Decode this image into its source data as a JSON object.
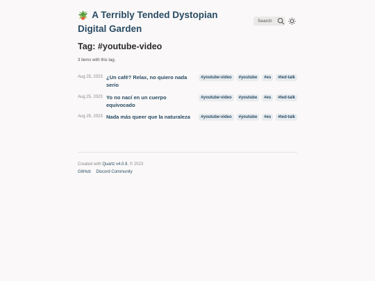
{
  "header": {
    "logo_emoji": "🪴",
    "site_title": "A Terribly Tended Dystopian Digital Garden",
    "search_label": "Search",
    "icons": {
      "search": "search-icon",
      "theme": "sun-icon"
    }
  },
  "page": {
    "title": "Tag: #youtube-video",
    "count_text": "3 items with this tag."
  },
  "items": [
    {
      "date": "Aug 25, 2023",
      "title": "¿Un café? Relax, no quiero nada serio",
      "tags": [
        "#youtube-video",
        "#youtube",
        "#es",
        "#ted-talk"
      ]
    },
    {
      "date": "Aug 25, 2023",
      "title": "Yo no nací en un cuerpo equivocado",
      "tags": [
        "#youtube-video",
        "#youtube",
        "#es",
        "#ted-talk"
      ]
    },
    {
      "date": "Aug 25, 2023",
      "title": "Nada más queer que la naturaleza",
      "tags": [
        "#youtube-video",
        "#youtube",
        "#es",
        "#ted-talk"
      ]
    }
  ],
  "footer": {
    "created_prefix": "Created with ",
    "quartz_link": "Quartz v4.0.9",
    "created_suffix": ", © 2023",
    "links": [
      "GitHub",
      "Discord Community"
    ]
  },
  "colors": {
    "accent": "#284b63",
    "background": "#faf8f8",
    "tag_bg": "#e8ecef"
  }
}
